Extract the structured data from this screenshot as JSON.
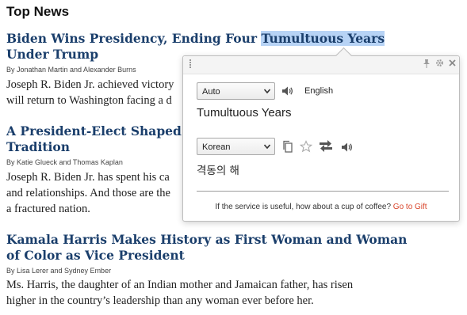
{
  "section_title": "Top News",
  "articles": [
    {
      "headline_part1": "Biden Wins Presidency, Ending Four ",
      "headline_highlight": "Tumultuous Years",
      "headline_part2": "Under Trump",
      "byline": "By Jonathan Martin and Alexander Burns",
      "summary_line1": "Joseph R. Biden Jr. achieved victory",
      "summary_line2": "will return to Washington facing a d"
    },
    {
      "headline_line1": "A President-Elect Shaped b",
      "headline_line2": "Tradition",
      "byline": "By Katie Glueck and Thomas Kaplan",
      "summary_line1": "Joseph R. Biden Jr. has spent his ca",
      "summary_line2": "and relationships. And those are the",
      "summary_line3": "a fractured nation."
    },
    {
      "headline_line1": "Kamala Harris Makes History as First Woman and Woman",
      "headline_line2": "of Color as Vice President",
      "byline": "By Lisa Lerer and Sydney Ember",
      "summary_line1": "Ms. Harris, the daughter of an Indian mother and Jamaican father, has risen",
      "summary_line2": "higher in the country’s leadership than any woman ever before her."
    }
  ],
  "translator": {
    "source_lang": "Auto",
    "target_lang_label": "English",
    "source_text": "Tumultuous Years",
    "result_lang": "Korean",
    "result_text": "격동의 해",
    "footer_text": "If the service is useful, how about a cup of coffee?",
    "footer_link": "Go to Gift",
    "icons": {
      "pin": "pin-icon",
      "settings": "gear-icon",
      "close": "close-icon",
      "speaker": "speaker-icon",
      "copy": "copy-icon",
      "star": "star-icon",
      "swap": "swap-icon"
    },
    "accent_color": "#d9452b",
    "highlight_color": "#b7d3f5",
    "headline_color": "#1a3e6b"
  }
}
